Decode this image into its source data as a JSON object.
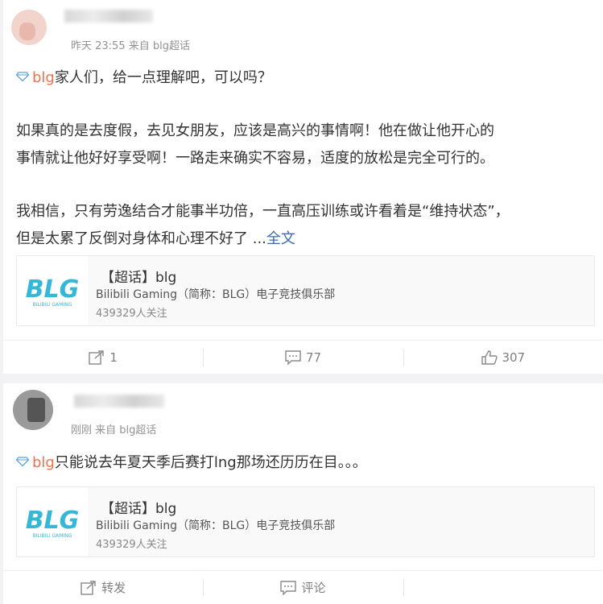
{
  "posts": [
    {
      "meta": "昨天 23:55 来自 blg超话",
      "topic": "blg",
      "line1": "家人们，给一点理解吧，可以吗？",
      "para2a": "如果真的是去度假，去见女朋友，应该是高兴的事情啊！他在做让他开心的",
      "para2b": "事情就让他好好享受啊！一路走来确实不容易，适度的放松是完全可行的。",
      "para3a": "我相信，只有劳逸结合才能事半功倍，一直高压训练或许看着是“维持状态”，",
      "para3b": "但是太累了反倒对身体和心理不好了",
      "ellipsis": " ...",
      "full_text_link": "全文",
      "topic_card": {
        "title": "【超话】blg",
        "desc": "Bilibili Gaming（简称：BLG）电子竞技俱乐部",
        "followers": "439329人关注",
        "logo": "BLG",
        "logo_sub": "BILIBILI GAMING"
      },
      "actions": {
        "repost": "1",
        "comment": "77",
        "like": "307"
      }
    },
    {
      "meta": "刚刚 来自 blg超话",
      "topic": "blg",
      "line1": "只能说去年夏天季后赛打lng那场还历历在目。。。",
      "topic_card": {
        "title": "【超话】blg",
        "desc": "Bilibili Gaming（简称：BLG）电子竞技俱乐部",
        "followers": "439329人关注",
        "logo": "BLG",
        "logo_sub": "BILIBILI GAMING"
      },
      "actions": {
        "repost": "转发",
        "comment": "评论"
      }
    }
  ],
  "colors": {
    "topic": "#eb7350",
    "link": "#3f6ba8",
    "logo": "#35b8d8"
  }
}
